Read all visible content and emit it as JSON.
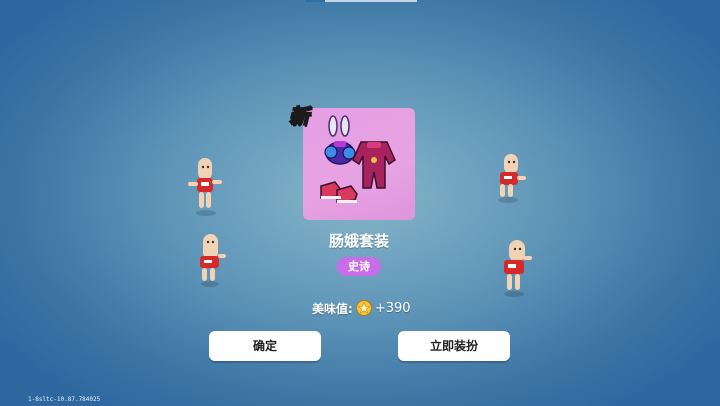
{
  "badge": {
    "new_label": "新"
  },
  "item": {
    "name": "肠娥套装",
    "rarity": "史诗"
  },
  "beauty": {
    "label": "美味值:",
    "value": "+390",
    "icon": "star-coin-icon"
  },
  "buttons": {
    "confirm": "确定",
    "equip_now": "立即装扮"
  },
  "version": "1-8sltc-10.87.784025",
  "colors": {
    "card": "#e6a3e2",
    "rarity": "#c86ce9",
    "badge_text": "#ffe34a",
    "button_bg": "#ffffff"
  }
}
